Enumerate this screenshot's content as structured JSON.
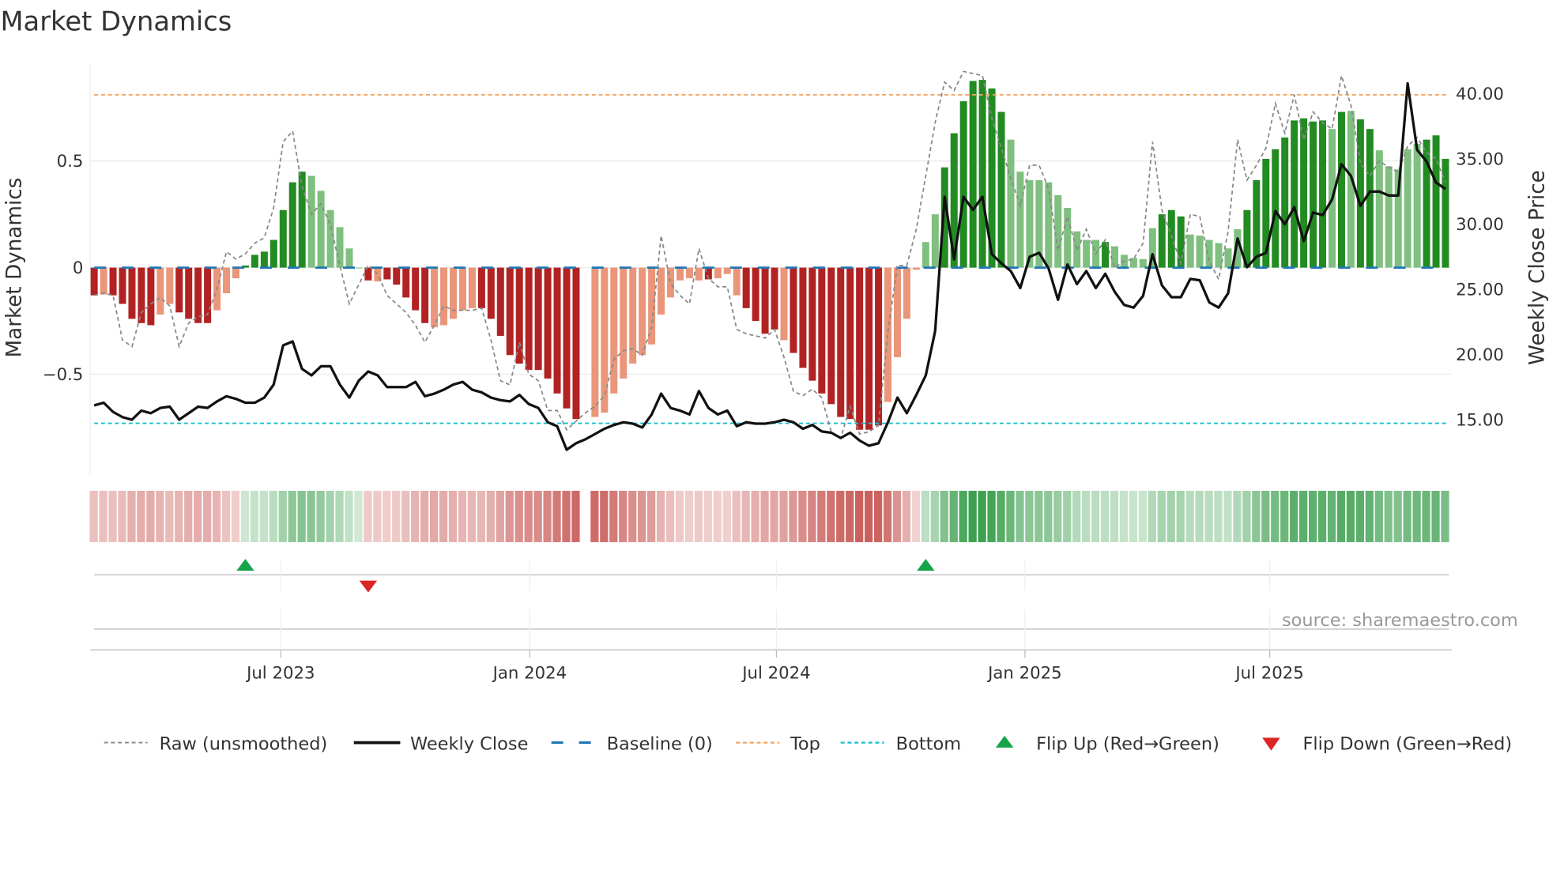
{
  "chart_data": {
    "type": "bar",
    "title": "Market Dynamics",
    "ylabel": "Market Dynamics",
    "ylabel_right": "Weekly Close Price",
    "ylim": [
      -0.97,
      0.97
    ],
    "ylim_right": [
      11.5,
      42.5
    ],
    "yticks": [
      {
        "v": 0.5,
        "label": "0.5"
      },
      {
        "v": 0,
        "label": "0"
      },
      {
        "v": -0.5,
        "label": "−0.5"
      }
    ],
    "yticks_right": [
      {
        "v": 15,
        "label": "15.00"
      },
      {
        "v": 20,
        "label": "20.00"
      },
      {
        "v": 25,
        "label": "25.00"
      },
      {
        "v": 30,
        "label": "30.00"
      },
      {
        "v": 35,
        "label": "35.00"
      },
      {
        "v": 40,
        "label": "40.00"
      }
    ],
    "xticks": [
      {
        "week": 19.75,
        "label": "Jul 2023"
      },
      {
        "week": 46.1,
        "label": "Jan 2024"
      },
      {
        "week": 72.2,
        "label": "Jul 2024"
      },
      {
        "week": 98.5,
        "label": "Jan 2025"
      },
      {
        "week": 124.4,
        "label": "Jul 2025"
      }
    ],
    "levels": {
      "top": 0.81,
      "bottom": -0.73,
      "baseline": 0
    },
    "grid": true,
    "values": [
      -0.13,
      -0.126,
      -0.13,
      -0.17,
      -0.24,
      -0.26,
      -0.27,
      -0.22,
      -0.17,
      -0.21,
      -0.24,
      -0.26,
      -0.26,
      -0.2,
      -0.12,
      -0.05,
      0.01,
      0.06,
      0.075,
      0.13,
      0.27,
      0.4,
      0.45,
      0.43,
      0.36,
      0.27,
      0.19,
      0.09,
      0,
      -0.06,
      -0.065,
      -0.055,
      -0.08,
      -0.14,
      -0.2,
      -0.26,
      -0.28,
      -0.27,
      -0.24,
      -0.2,
      -0.19,
      -0.19,
      -0.24,
      -0.32,
      -0.41,
      -0.45,
      -0.48,
      -0.48,
      -0.52,
      -0.59,
      -0.66,
      -0.71,
      null,
      -0.7,
      -0.68,
      -0.59,
      -0.52,
      -0.45,
      -0.41,
      -0.36,
      -0.22,
      -0.14,
      -0.06,
      -0.05,
      -0.06,
      -0.055,
      -0.05,
      -0.03,
      -0.13,
      -0.19,
      -0.25,
      -0.31,
      -0.29,
      -0.34,
      -0.4,
      -0.47,
      -0.53,
      -0.59,
      -0.64,
      -0.7,
      -0.71,
      -0.76,
      -0.76,
      -0.74,
      -0.63,
      -0.42,
      -0.24,
      -0.01,
      0.12,
      0.25,
      0.47,
      0.63,
      0.78,
      0.875,
      0.88,
      0.84,
      0.73,
      0.6,
      0.45,
      0.41,
      0.41,
      0.4,
      0.34,
      0.28,
      0.17,
      0.13,
      0.13,
      0.12,
      0.1,
      0.06,
      0.045,
      0.04,
      0.185,
      0.25,
      0.27,
      0.24,
      0.155,
      0.15,
      0.13,
      0.115,
      0.09,
      0.18,
      0.27,
      0.41,
      0.51,
      0.555,
      0.61,
      0.69,
      0.7,
      0.685,
      0.69,
      0.65,
      0.73,
      0.735,
      0.695,
      0.65,
      0.55,
      0.475,
      0.46,
      0.555,
      0.58,
      0.6,
      0.62,
      0.51
    ],
    "shade": "dldddddllddddllldddddddlllllldldddddlllllddddddddddddlllllllllllldllldddd lddddddddddlllllldddddddlllllllllldllllldddlllllldddddddddldlddllllldddddl",
    "raw": [
      -0.13,
      -0.12,
      -0.13,
      -0.34,
      -0.37,
      -0.21,
      -0.17,
      -0.14,
      -0.18,
      -0.37,
      -0.26,
      -0.23,
      -0.22,
      -0.1,
      0.075,
      0.04,
      0.065,
      0.115,
      0.14,
      0.28,
      0.59,
      0.64,
      0.38,
      0.25,
      0.3,
      0.2,
      0.01,
      -0.17,
      -0.08,
      0.01,
      -0.03,
      -0.13,
      -0.17,
      -0.21,
      -0.27,
      -0.35,
      -0.27,
      -0.18,
      -0.2,
      -0.2,
      -0.2,
      -0.19,
      -0.34,
      -0.53,
      -0.55,
      -0.35,
      -0.5,
      -0.53,
      -0.67,
      -0.67,
      -0.76,
      -0.72,
      -0.68,
      -0.65,
      -0.6,
      -0.43,
      -0.39,
      -0.38,
      -0.41,
      -0.28,
      0.15,
      -0.075,
      -0.13,
      -0.17,
      0.09,
      -0.05,
      -0.09,
      -0.09,
      -0.29,
      -0.31,
      -0.32,
      -0.33,
      -0.29,
      -0.42,
      -0.58,
      -0.6,
      -0.57,
      -0.61,
      -0.77,
      -0.8,
      -0.65,
      -0.78,
      -0.77,
      -0.74,
      -0.3,
      0.01,
      0.01,
      0.18,
      0.43,
      0.68,
      0.87,
      0.83,
      0.92,
      0.91,
      0.9,
      0.7,
      0.56,
      0.42,
      0.29,
      0.48,
      0.48,
      0.37,
      0.08,
      0.24,
      0.08,
      0.18,
      0.065,
      0.13,
      0,
      0.03,
      0.04,
      0.115,
      0.59,
      0.27,
      0.15,
      0.02,
      0.25,
      0.24,
      0.03,
      -0.055,
      0.17,
      0.6,
      0.41,
      0.48,
      0.56,
      0.77,
      0.63,
      0.81,
      0.6,
      0.73,
      0.68,
      0.65,
      0.9,
      0.76,
      0.49,
      0.43,
      0.5,
      0.47,
      0.45,
      0.57,
      0.61,
      0.54,
      0.51,
      0.4
    ],
    "close": [
      16.1,
      16.3,
      15.6,
      15.2,
      15.0,
      15.7,
      15.5,
      15.9,
      16.0,
      15.0,
      15.5,
      16.0,
      15.9,
      16.4,
      16.8,
      16.6,
      16.3,
      16.3,
      16.7,
      17.7,
      20.7,
      21.0,
      18.9,
      18.4,
      19.1,
      19.1,
      17.7,
      16.7,
      18.0,
      18.7,
      18.4,
      17.5,
      17.5,
      17.5,
      17.9,
      16.8,
      17.0,
      17.3,
      17.7,
      17.9,
      17.3,
      17.1,
      16.7,
      16.5,
      16.4,
      16.9,
      16.2,
      15.9,
      14.8,
      14.5,
      12.7,
      13.2,
      13.5,
      13.9,
      14.3,
      14.6,
      14.8,
      14.7,
      14.4,
      15.4,
      17.0,
      15.9,
      15.7,
      15.4,
      17.2,
      15.9,
      15.4,
      15.7,
      14.5,
      14.8,
      14.7,
      14.7,
      14.8,
      15.0,
      14.8,
      14.3,
      14.6,
      14.1,
      14.0,
      13.6,
      14.0,
      13.4,
      13.0,
      13.2,
      14.8,
      16.7,
      15.5,
      16.9,
      18.4,
      21.8,
      32.1,
      27.3,
      32.1,
      31.1,
      32.1,
      27.7,
      27.0,
      26.4,
      25.1,
      27.5,
      27.8,
      26.6,
      24.2,
      26.9,
      25.4,
      26.4,
      25.1,
      26.2,
      24.8,
      23.8,
      23.6,
      24.5,
      27.7,
      25.3,
      24.4,
      24.4,
      25.8,
      25.7,
      24.0,
      23.6,
      24.7,
      28.9,
      26.7,
      27.5,
      27.8,
      31.0,
      30.0,
      31.3,
      28.7,
      30.9,
      30.7,
      31.9,
      34.6,
      33.7,
      31.4,
      32.5,
      32.5,
      32.2,
      32.2,
      40.8,
      35.7,
      34.8,
      33.2,
      32.7
    ],
    "flips": [
      {
        "week": 16,
        "dir": "up"
      },
      {
        "week": 29,
        "dir": "down"
      },
      {
        "week": 88,
        "dir": "up"
      }
    ],
    "legend": {
      "placement": "bottom",
      "raw": "Raw (unsmoothed)",
      "close": "Weekly Close",
      "baseline": "Baseline (0)",
      "top": "Top",
      "bottom": "Bottom",
      "flip_up": "Flip Up (Red→Green)",
      "flip_down": "Flip Down (Green→Red)"
    },
    "source": "source: sharemaestro.com",
    "colors": {
      "dark_red": "#b22222",
      "light_red": "#e9967a",
      "dark_green": "#228b22",
      "light_green": "#7fbf7f",
      "raw": "#888888",
      "close": "#111111",
      "baseline": "#1f77b4",
      "top": "#f4a460",
      "bottom": "#17becf",
      "flip_up": "#16a34a",
      "flip_down": "#dc2626"
    }
  }
}
